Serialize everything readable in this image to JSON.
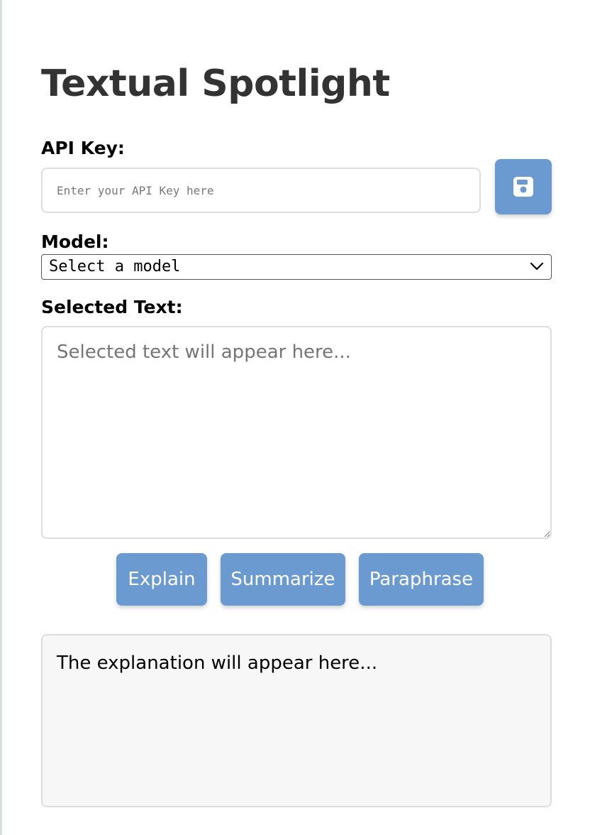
{
  "app": {
    "title": "Textual Spotlight"
  },
  "api_key": {
    "label": "API Key:",
    "value": "",
    "placeholder": "Enter your API Key here",
    "save_icon": "floppy-disk-icon"
  },
  "model": {
    "label": "Model:",
    "selected": "Select a model",
    "chevron_icon": "chevron-down-icon"
  },
  "selected_text": {
    "label": "Selected Text:",
    "value": "",
    "placeholder": "Selected text will appear here..."
  },
  "actions": {
    "explain": "Explain",
    "summarize": "Summarize",
    "paraphrase": "Paraphrase"
  },
  "output": {
    "text": "The explanation will appear here..."
  },
  "colors": {
    "accent": "#6a9ad0",
    "title": "#333333",
    "output_bg": "#f7f7f7",
    "border": "#dddddd"
  }
}
